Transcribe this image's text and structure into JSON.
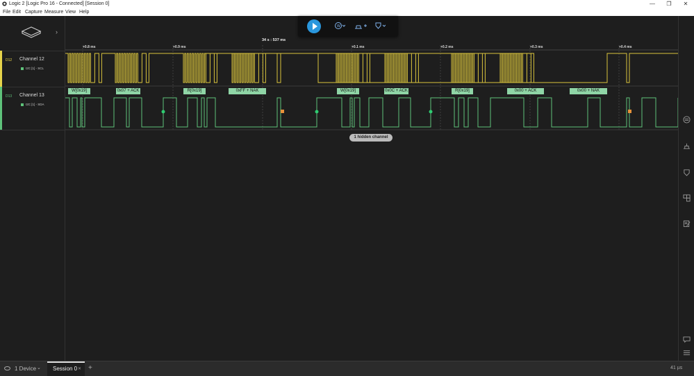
{
  "window": {
    "title": "Logic 2 [Logic Pro 16 - Connected] [Session 0]",
    "minimize": "—",
    "maximize": "❐",
    "close": "✕"
  },
  "menu": [
    "File",
    "Edit",
    "Capture",
    "Measure",
    "View",
    "Help"
  ],
  "timeline": {
    "cursor_time": "34 s : 537 ms",
    "ticks": [
      "+0.8 ms",
      "+0.9 ms",
      "+0.1 ms",
      "+0.2 ms",
      "+0.3 ms",
      "+0.4 ms"
    ]
  },
  "channels": [
    {
      "id": "D12",
      "name": "Channel 12",
      "analyzer": "I2C [1] - SCL",
      "color": "#e6d34a"
    },
    {
      "id": "D13",
      "name": "Channel 13",
      "analyzer": "I2C [1] - SDA",
      "color": "#5ec27a"
    }
  ],
  "decoded_frames": [
    "W[0x19]",
    "0x07 + ACK",
    "R[0x19]",
    "0xFF + NAK",
    "W[0x19]",
    "0x0C + ACK",
    "R[0x19]",
    "0x00 + ACK",
    "0x00 + NAK"
  ],
  "hidden_channels": "1 hidden channel",
  "bottom": {
    "device_tab": "1 Device",
    "session_tab": "Session 0",
    "add_tab": "+",
    "zoom": "41 µs"
  },
  "icons": {
    "toolbar": [
      "play-icon",
      "trigger-icon",
      "measure-icon",
      "marker-icon"
    ],
    "rail": [
      "analyzers-icon",
      "timing-marker-icon",
      "annotations-icon",
      "extensions-icon",
      "notes-icon",
      "feedback-icon",
      "menu-icon"
    ]
  }
}
